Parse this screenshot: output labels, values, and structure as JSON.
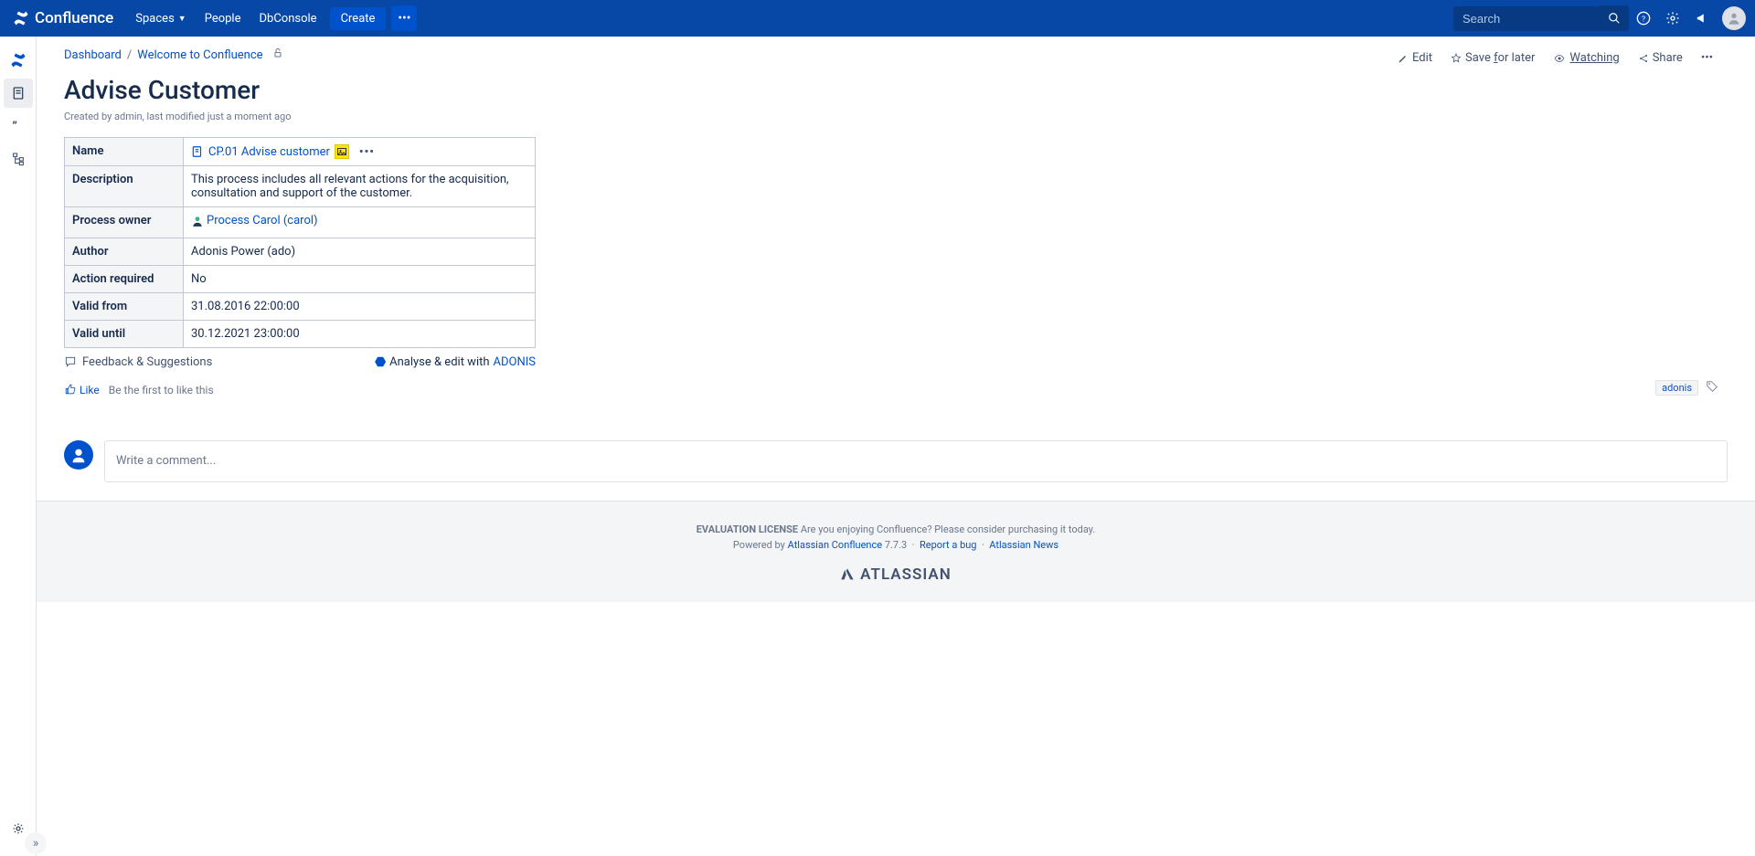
{
  "topbar": {
    "brand": "Confluence",
    "nav": {
      "spaces": "Spaces",
      "people": "People",
      "dbconsole": "DbConsole"
    },
    "create": "Create",
    "search_placeholder": "Search"
  },
  "breadcrumbs": {
    "dashboard": "Dashboard",
    "welcome": "Welcome to Confluence"
  },
  "actions": {
    "edit": "Edit",
    "save": "Save for later",
    "save_u": "f",
    "watching": "Watching",
    "watching_u": "W",
    "share": "Share"
  },
  "page": {
    "title": "Advise Customer",
    "meta_prefix": "Created by ",
    "meta_author": "admin",
    "meta_mid": ", last modified ",
    "meta_time": "just a moment ago"
  },
  "table": {
    "labels": {
      "name": "Name",
      "description": "Description",
      "owner": "Process owner",
      "author": "Author",
      "action": "Action required",
      "from": "Valid from",
      "until": "Valid until"
    },
    "values": {
      "name_link": "CP.01 Advise customer",
      "description": "This process includes all relevant actions for the acquisition, consultation and support of the customer.",
      "owner_link": "Process Carol (carol)",
      "author": "Adonis Power (ado)",
      "action": "No",
      "from": "31.08.2016 22:00:00",
      "until": "30.12.2021 23:00:00"
    }
  },
  "under_table": {
    "feedback": "Feedback & Suggestions",
    "analyse_prefix": "Analyse & edit with ",
    "analyse_link": "ADONIS"
  },
  "like": {
    "like": "Like",
    "first": "Be the first to like this"
  },
  "tags": {
    "adonis": "adonis"
  },
  "comment": {
    "placeholder": "Write a comment..."
  },
  "footer": {
    "eval_bold": "EVALUATION LICENSE",
    "eval_text": " Are you enjoying Confluence? Please consider purchasing it today.",
    "powered": "Powered by ",
    "product": "Atlassian Confluence",
    "version": " 7.7.3",
    "bug": "Report a bug",
    "news": "Atlassian News",
    "atlassian": "ATLASSIAN"
  }
}
